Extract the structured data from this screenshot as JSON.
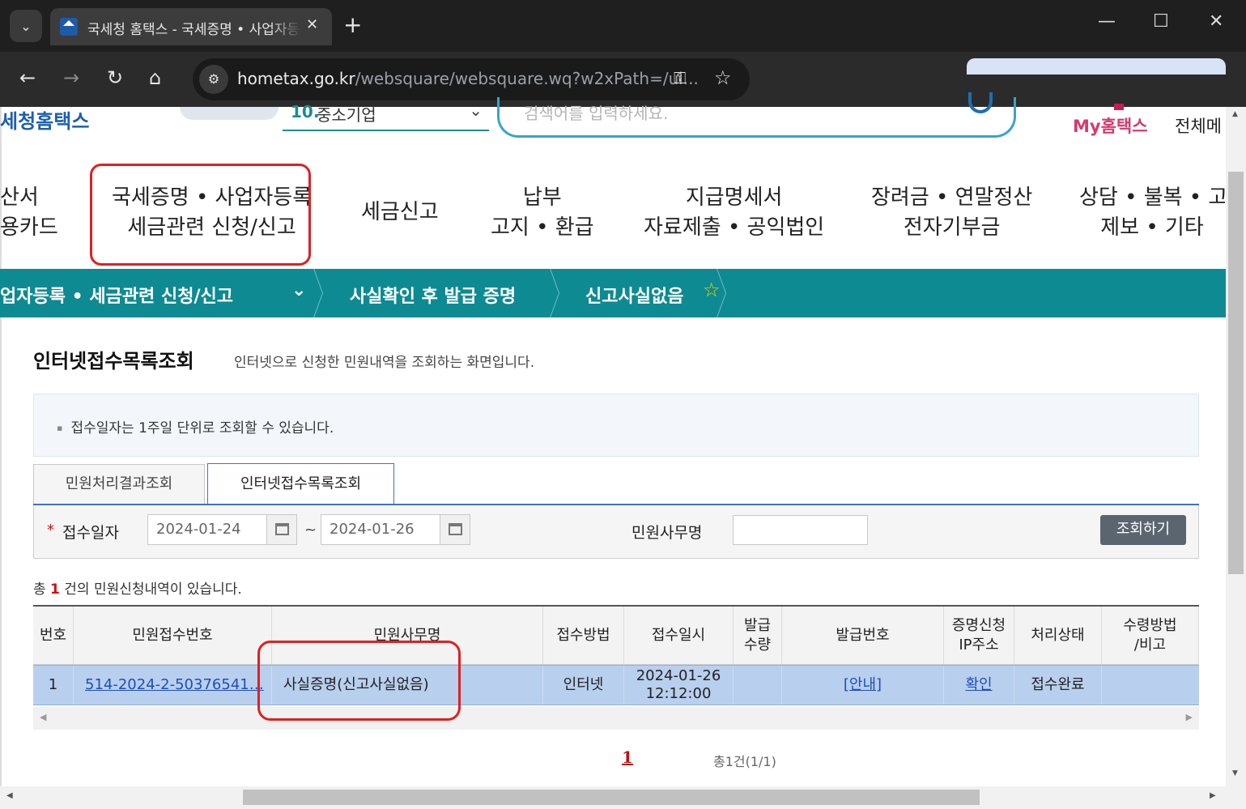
{
  "browser": {
    "tab_title": "국세청 홈택스 - 국세증명 • 사업자등록",
    "favicon_text": "Home",
    "url_host": "hometax.go.kr",
    "url_path": "/websquare/websquare.wq?w2xPath=/ui..."
  },
  "header": {
    "logo": "세청홈택스",
    "biz_select_num": "10.",
    "biz_select_value": "중소기업",
    "search_placeholder": "검색어를 입력하세요.",
    "my_hometax": "My홈택스",
    "all_menu": "전체메"
  },
  "main_menu": [
    {
      "line1": "산서",
      "line2": "용카드"
    },
    {
      "line1": "국세증명 • 사업자등록",
      "line2": "세금관련 신청/신고"
    },
    {
      "line1": "세금신고",
      "line2": ""
    },
    {
      "line1": "납부",
      "line2": "고지 • 환급"
    },
    {
      "line1": "지급명세서",
      "line2": "자료제출 • 공익법인"
    },
    {
      "line1": "장려금 • 연말정산",
      "line2": "전자기부금"
    },
    {
      "line1": "상담 • 불복 • 고충",
      "line2": "제보 • 기타"
    }
  ],
  "breadcrumb": {
    "item1": "업자등록 • 세금관련 신청/신고",
    "item2": "사실확인 후 발급 증명",
    "item3": "신고사실없음"
  },
  "page": {
    "title": "인터넷접수목록조회",
    "description": "인터넷으로 신청한 민원내역을 조회하는 화면입니다.",
    "notice": "접수일자는 1주일 단위로 조회할 수 있습니다."
  },
  "tabs": [
    {
      "label": "민원처리결과조회",
      "active": false
    },
    {
      "label": "인터넷접수목록조회",
      "active": true
    }
  ],
  "filter": {
    "required_mark": "*",
    "date_label": "접수일자",
    "date_from": "2024-01-24",
    "tilde": "~",
    "date_to": "2024-01-26",
    "name_label": "민원사무명",
    "name_value": "",
    "query_button": "조회하기"
  },
  "result": {
    "prefix": "총",
    "count": "1",
    "suffix": "건의 민원신청내역이 있습니다."
  },
  "table": {
    "headers": [
      "번호",
      "민원접수번호",
      "민원사무명",
      "접수방법",
      "접수일시",
      "발급\n수량",
      "발급번호",
      "증명신청\nIP주소",
      "처리상태",
      "수령방법\n/비고"
    ],
    "rows": [
      {
        "no": "1",
        "receipt_no": "514-2024-2-50376541…",
        "service_name": "사실증명(신고사실없음)",
        "method": "인터넷",
        "datetime": "2024-01-26\n12:12:00",
        "qty": "",
        "issue_no": "[안내]",
        "ip": "확인",
        "status": "접수완료",
        "note": ""
      }
    ]
  },
  "pagination": {
    "current": "1",
    "total": "총1건(1/1)"
  },
  "colors": {
    "breadcrumb_bg": "#0e8a92",
    "selected_row": "#b9cfee",
    "highlight_box": "#e02020",
    "link": "#1d4fb8"
  }
}
